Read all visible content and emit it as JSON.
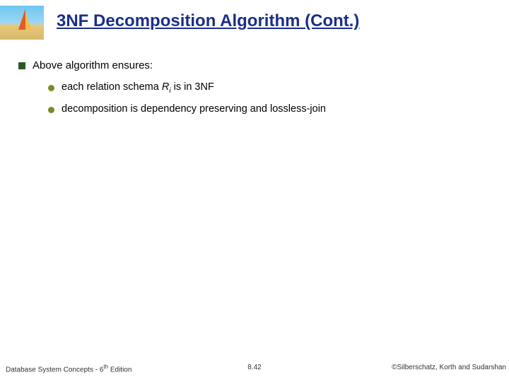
{
  "title": "3NF Decomposition Algorithm (Cont.)",
  "bullets": {
    "main": "Above algorithm ensures:",
    "sub": [
      {
        "pre": "each relation schema ",
        "var": "R",
        "sub": "i",
        "post": " is in 3NF"
      },
      {
        "pre": "decomposition is dependency preserving and lossless-join",
        "var": "",
        "sub": "",
        "post": ""
      }
    ]
  },
  "footer": {
    "left_pre": "Database System Concepts - 6",
    "left_sup": "th",
    "left_post": " Edition",
    "center": "8.42",
    "right": "©Silberschatz, Korth and Sudarshan"
  }
}
